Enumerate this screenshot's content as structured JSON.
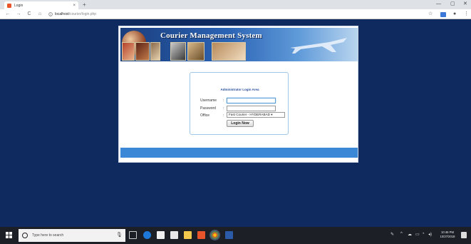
{
  "browser": {
    "tab_title": "Login",
    "tab_close": "×",
    "new_tab": "+",
    "nav": {
      "back": "←",
      "forward": "→",
      "reload": "C",
      "home": "⌂"
    },
    "address": {
      "host": "localhost",
      "path": "/courier/login.php"
    },
    "window_controls": {
      "minimize": "—",
      "maximize": "▢",
      "close": "✕"
    },
    "toolbar_icons": {
      "star": "☆",
      "account": "●",
      "menu": "⋮"
    }
  },
  "page": {
    "banner_title": "Courier Management System",
    "login": {
      "heading": "Administrator Login Area",
      "username_label": "Username",
      "password_label": "Password",
      "office_label": "Office",
      "colon": ":",
      "office_selected": "Fast Courier - HYDERABAD ▾",
      "button_label": "Login Now"
    }
  },
  "taskbar": {
    "search_placeholder": "Type here to search",
    "clock_time": "10:46 PM",
    "clock_date": "10/27/2018"
  },
  "colors": {
    "page_background": "#0f2a5f",
    "banner_blue": "#1a3d7c",
    "footer_bar": "#3a88d6",
    "login_heading": "#2a4f9e"
  }
}
